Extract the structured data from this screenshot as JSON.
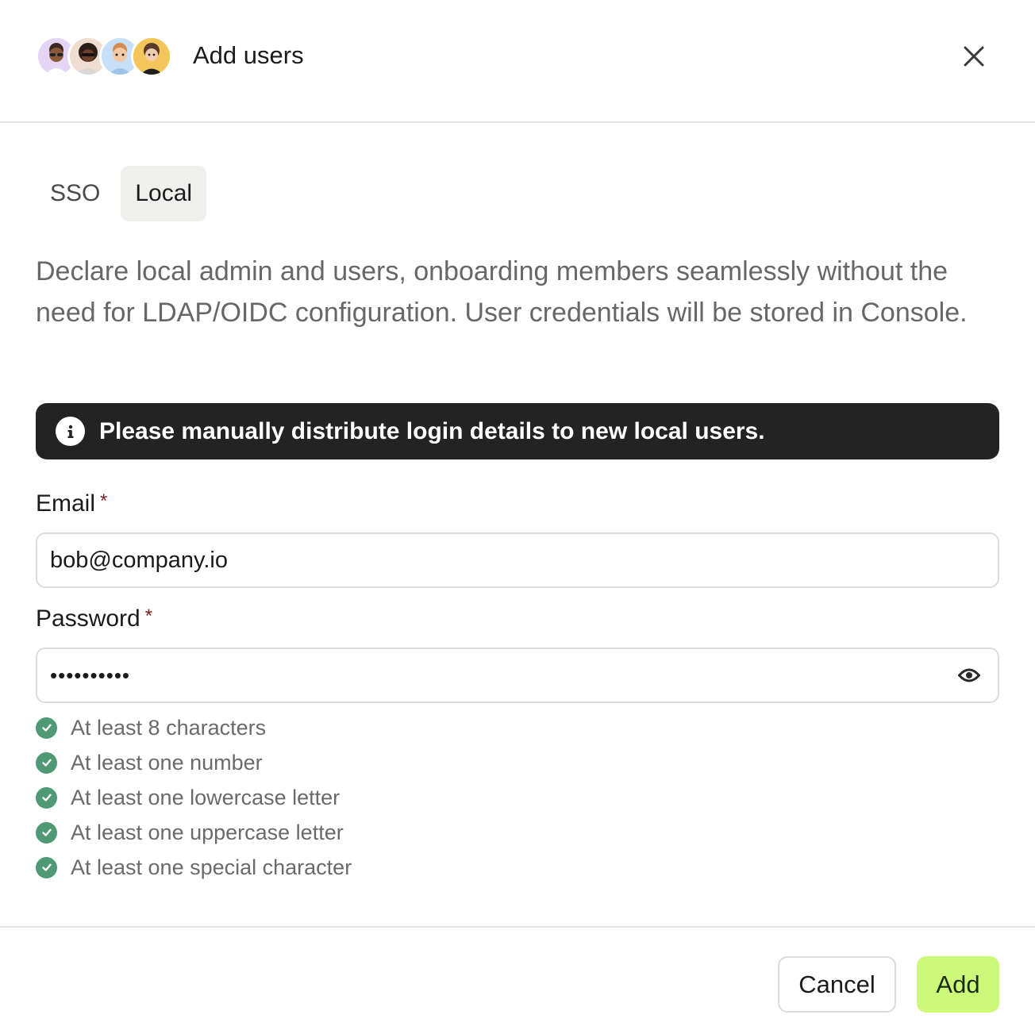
{
  "header": {
    "title": "Add users",
    "avatars": [
      {
        "name": "avatar-1",
        "bg": "#e4d5f5"
      },
      {
        "name": "avatar-2",
        "bg": "#eeddd0"
      },
      {
        "name": "avatar-3",
        "bg": "#c7e0f7"
      },
      {
        "name": "avatar-4",
        "bg": "#f3c55a"
      }
    ],
    "close_icon": "close-icon"
  },
  "tabs": [
    {
      "label": "SSO",
      "active": false
    },
    {
      "label": "Local",
      "active": true
    }
  ],
  "description": "Declare local admin and users, onboarding members seamlessly without the need for LDAP/OIDC configuration. User credentials will be stored in Console.",
  "banner": {
    "icon": "info-icon",
    "text": "Please manually distribute login details to new local users."
  },
  "form": {
    "email": {
      "label": "Email",
      "required_mark": "*",
      "value": "bob@company.io"
    },
    "password": {
      "label": "Password",
      "required_mark": "*",
      "masked_value": "••••••••••",
      "toggle_icon": "eye-icon"
    }
  },
  "password_rules": [
    {
      "text": "At least 8 characters",
      "met": true
    },
    {
      "text": "At least one number",
      "met": true
    },
    {
      "text": "At least one lowercase letter",
      "met": true
    },
    {
      "text": "At least one uppercase letter",
      "met": true
    },
    {
      "text": "At least one special character",
      "met": true
    }
  ],
  "footer": {
    "cancel_label": "Cancel",
    "add_label": "Add"
  },
  "colors": {
    "accent": "#cdf97b",
    "success": "#4f9a74",
    "banner_bg": "#222322",
    "required": "#7a1f1f"
  }
}
